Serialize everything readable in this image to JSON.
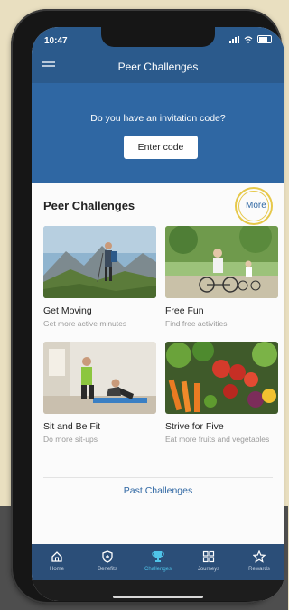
{
  "status": {
    "time": "10:47"
  },
  "header": {
    "title": "Peer Challenges",
    "menu_icon": "hamburger-menu-icon"
  },
  "invite": {
    "prompt": "Do you have an invitation code?",
    "button": "Enter code"
  },
  "section": {
    "title": "Peer Challenges",
    "more": "More"
  },
  "cards": [
    {
      "name": "Get Moving",
      "desc": "Get more active minutes"
    },
    {
      "name": "Free Fun",
      "desc": "Find free activities"
    },
    {
      "name": "Sit and Be Fit",
      "desc": "Do more sit-ups"
    },
    {
      "name": "Strive for Five",
      "desc": "Eat more fruits and vegetables"
    }
  ],
  "past": "Past Challenges",
  "tabs": [
    {
      "label": "Home",
      "icon": "home-icon"
    },
    {
      "label": "Benefits",
      "icon": "shield-plus-icon"
    },
    {
      "label": "Challenges",
      "icon": "trophy-icon",
      "active": true
    },
    {
      "label": "Journeys",
      "icon": "grid-icon"
    },
    {
      "label": "Rewards",
      "icon": "star-icon"
    }
  ],
  "colors": {
    "primary": "#2f67a3",
    "tabbar": "#2b4e78",
    "active_tab": "#4fc3e8",
    "highlight": "#e6c84a"
  }
}
